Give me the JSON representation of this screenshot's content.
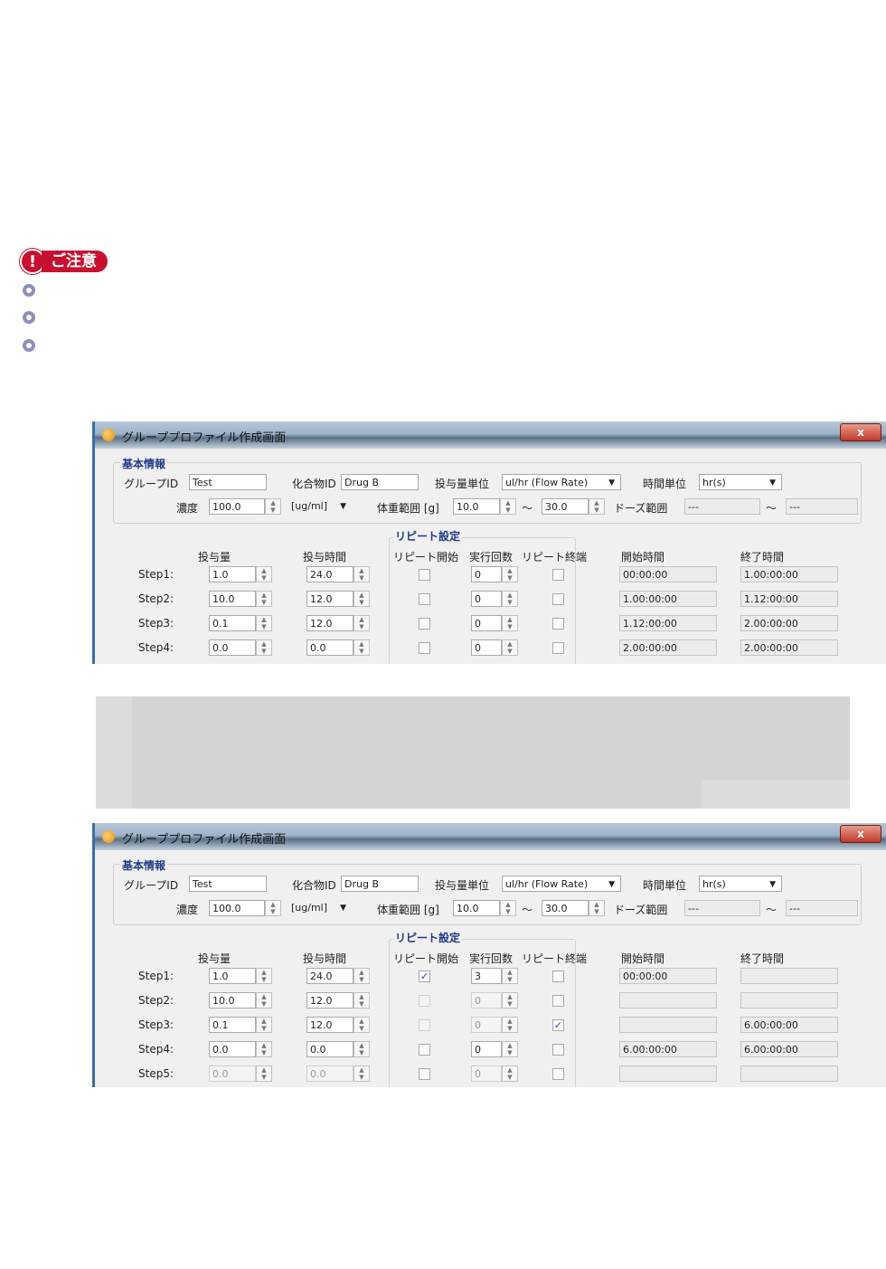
{
  "caution": {
    "icon": "exclamation-icon",
    "label": "ご注意",
    "accent": "#c8102e"
  },
  "bullets": [
    {
      "icon": "bullet-icon"
    },
    {
      "icon": "bullet-icon"
    },
    {
      "icon": "bullet-icon"
    }
  ],
  "dialog1": {
    "title": "グループプロファイル作成画面",
    "close": "x",
    "basic_title": "基本情報",
    "group_id_label": "グループID",
    "group_id": "Test",
    "compound_label": "化合物ID",
    "compound": "Drug B",
    "dose_unit_label": "投与量単位",
    "dose_unit": "ul/hr (Flow Rate)",
    "time_unit_label": "時間単位",
    "time_unit": "hr(s)",
    "conc_label": "濃度",
    "conc": "100.0",
    "conc_unit": "[ug/ml]",
    "weight_label": "体重範囲 [g]",
    "weight_min": "10.0",
    "tilde": "～",
    "weight_max": "30.0",
    "dose_range_label": "ドーズ範囲",
    "dose_range_min": "---",
    "dose_range_max": "---",
    "repeat_title": "リピート設定",
    "col_dose": "投与量",
    "col_time": "投与時間",
    "col_repeat_start": "リピート開始",
    "col_count": "実行回数",
    "col_repeat_end": "リピート終端",
    "col_start": "開始時間",
    "col_end": "終了時間",
    "rows": [
      {
        "step": "Step1:",
        "dose": "1.0",
        "time": "24.0",
        "rs": "",
        "count": "0",
        "re": "",
        "start": "00:00:00",
        "end": "1.00:00:00"
      },
      {
        "step": "Step2:",
        "dose": "10.0",
        "time": "12.0",
        "rs": "",
        "count": "0",
        "re": "",
        "start": "1.00:00:00",
        "end": "1.12:00:00"
      },
      {
        "step": "Step3:",
        "dose": "0.1",
        "time": "12.0",
        "rs": "",
        "count": "0",
        "re": "",
        "start": "1.12:00:00",
        "end": "2.00:00:00"
      },
      {
        "step": "Step4:",
        "dose": "0.0",
        "time": "0.0",
        "rs": "",
        "count": "0",
        "re": "",
        "start": "2.00:00:00",
        "end": "2.00:00:00"
      }
    ]
  },
  "dialog2": {
    "title": "グループプロファイル作成画面",
    "close": "x",
    "basic_title": "基本情報",
    "group_id_label": "グループID",
    "group_id": "Test",
    "compound_label": "化合物ID",
    "compound": "Drug B",
    "dose_unit_label": "投与量単位",
    "dose_unit": "ul/hr (Flow Rate)",
    "time_unit_label": "時間単位",
    "time_unit": "hr(s)",
    "conc_label": "濃度",
    "conc": "100.0",
    "conc_unit": "[ug/ml]",
    "weight_label": "体重範囲 [g]",
    "weight_min": "10.0",
    "tilde": "～",
    "weight_max": "30.0",
    "dose_range_label": "ドーズ範囲",
    "dose_range_min": "---",
    "dose_range_max": "---",
    "repeat_title": "リピート設定",
    "col_dose": "投与量",
    "col_time": "投与時間",
    "col_repeat_start": "リピート開始",
    "col_count": "実行回数",
    "col_repeat_end": "リピート終端",
    "col_start": "開始時間",
    "col_end": "終了時間",
    "rows": [
      {
        "step": "Step1:",
        "dose": "1.0",
        "time": "24.0",
        "rs": "✓",
        "count": "3",
        "re": "",
        "start": "00:00:00",
        "end": ""
      },
      {
        "step": "Step2:",
        "dose": "10.0",
        "time": "12.0",
        "rs": "",
        "count": "0",
        "re": "",
        "start": "",
        "end": ""
      },
      {
        "step": "Step3:",
        "dose": "0.1",
        "time": "12.0",
        "rs": "",
        "count": "0",
        "re": "✓",
        "start": "",
        "end": "6.00:00:00"
      },
      {
        "step": "Step4:",
        "dose": "0.0",
        "time": "0.0",
        "rs": "",
        "count": "0",
        "re": "",
        "start": "6.00:00:00",
        "end": "6.00:00:00"
      },
      {
        "step": "Step5:",
        "dose": "0.0",
        "time": "0.0",
        "rs": "",
        "count": "0",
        "re": "",
        "start": "",
        "end": ""
      }
    ]
  }
}
